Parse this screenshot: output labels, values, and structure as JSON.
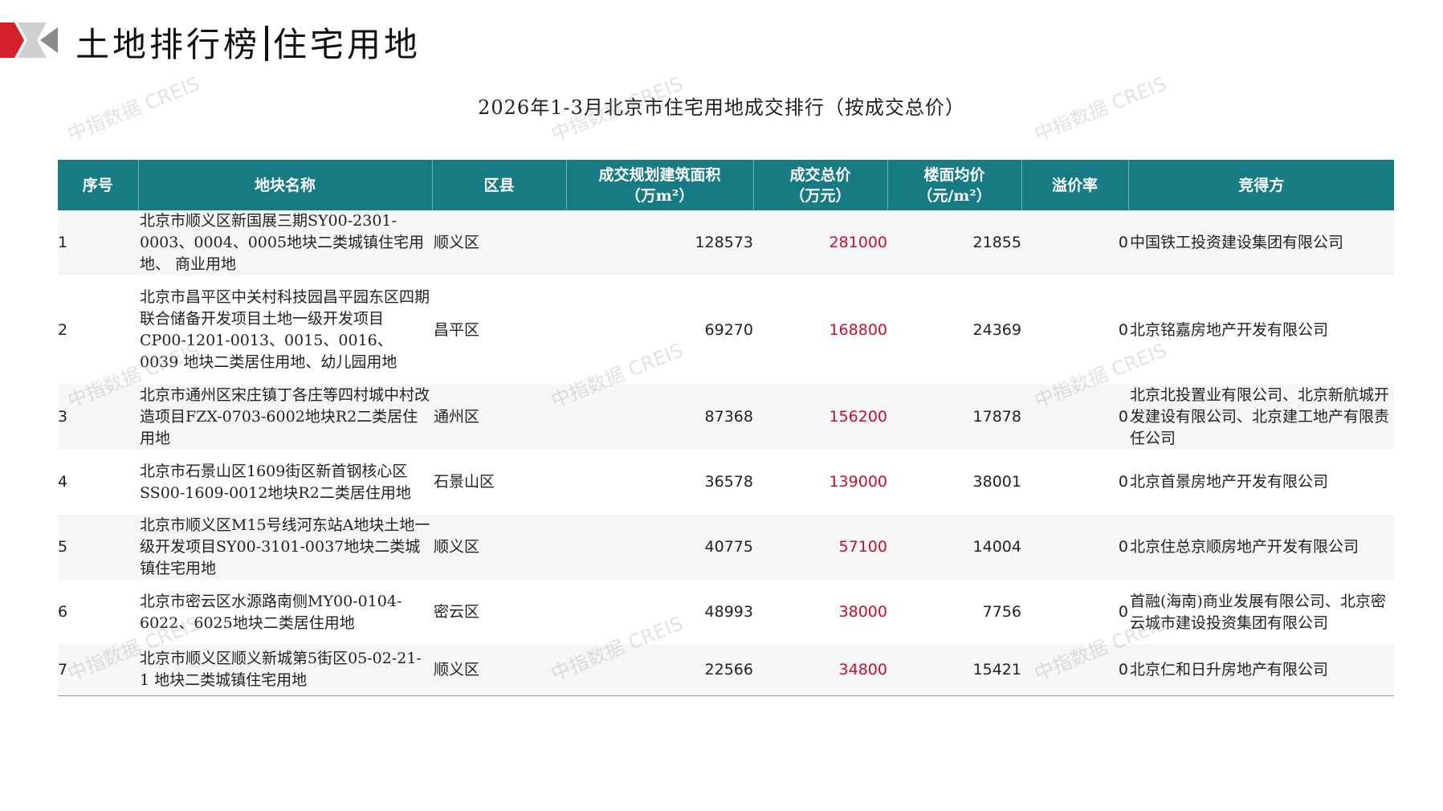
{
  "header": {
    "title_left": "土地排行榜",
    "title_right": "住宅用地"
  },
  "table_title": "2026年1-3月北京市住宅用地成交排行（按成交总价）",
  "watermark": "中指数据 CREIS",
  "colors": {
    "header_bg": "#177b83",
    "accent_red": "#c8102e",
    "logo_gray": "#8a8a8a"
  },
  "columns": {
    "seq": "序号",
    "name": "地块名称",
    "district": "区县",
    "area": "成交规划建筑面积\n（万m²）",
    "total": "成交总价\n（万元）",
    "unit": "楼面均价\n（元/m²）",
    "premium": "溢价率",
    "winner": "竞得方"
  },
  "rows": [
    {
      "seq": "1",
      "name": "北京市顺义区新国展三期SY00-2301-0003、0004、0005地块二类城镇住宅用地、 商业用地",
      "district": "顺义区",
      "area": "128573",
      "total": "281000",
      "unit": "21855",
      "premium": "0",
      "winner": "中国铁工投资建设集团有限公司"
    },
    {
      "seq": "2",
      "name": "北京市昌平区中关村科技园昌平园东区四期联合储备开发项目土地一级开发项目 CP00-1201-0013、0015、0016、0039 地块二类居住用地、幼儿园用地",
      "district": "昌平区",
      "area": "69270",
      "total": "168800",
      "unit": "24369",
      "premium": "0",
      "winner": "北京铭嘉房地产开发有限公司"
    },
    {
      "seq": "3",
      "name": "北京市通州区宋庄镇丁各庄等四村城中村改造项目FZX-0703-6002地块R2二类居住用地",
      "district": "通州区",
      "area": "87368",
      "total": "156200",
      "unit": "17878",
      "premium": "0",
      "winner": "北京北投置业有限公司、北京新航城开发建设有限公司、北京建工地产有限责任公司"
    },
    {
      "seq": "4",
      "name": "北京市石景山区1609街区新首钢核心区SS00-1609-0012地块R2二类居住用地",
      "district": "石景山区",
      "area": "36578",
      "total": "139000",
      "unit": "38001",
      "premium": "0",
      "winner": "北京首景房地产开发有限公司"
    },
    {
      "seq": "5",
      "name": "北京市顺义区M15号线河东站A地块土地一级开发项目SY00-3101-0037地块二类城镇住宅用地",
      "district": "顺义区",
      "area": "40775",
      "total": "57100",
      "unit": "14004",
      "premium": "0",
      "winner": "北京住总京顺房地产开发有限公司"
    },
    {
      "seq": "6",
      "name": "北京市密云区水源路南侧MY00-0104-6022、6025地块二类居住用地",
      "district": "密云区",
      "area": "48993",
      "total": "38000",
      "unit": "7756",
      "premium": "0",
      "winner": "首融(海南)商业发展有限公司、北京密云城市建设投资集团有限公司"
    },
    {
      "seq": "7",
      "name": "北京市顺义区顺义新城第5街区05-02-21-1 地块二类城镇住宅用地",
      "district": "顺义区",
      "area": "22566",
      "total": "34800",
      "unit": "15421",
      "premium": "0",
      "winner": "北京仁和日升房地产有限公司"
    }
  ]
}
